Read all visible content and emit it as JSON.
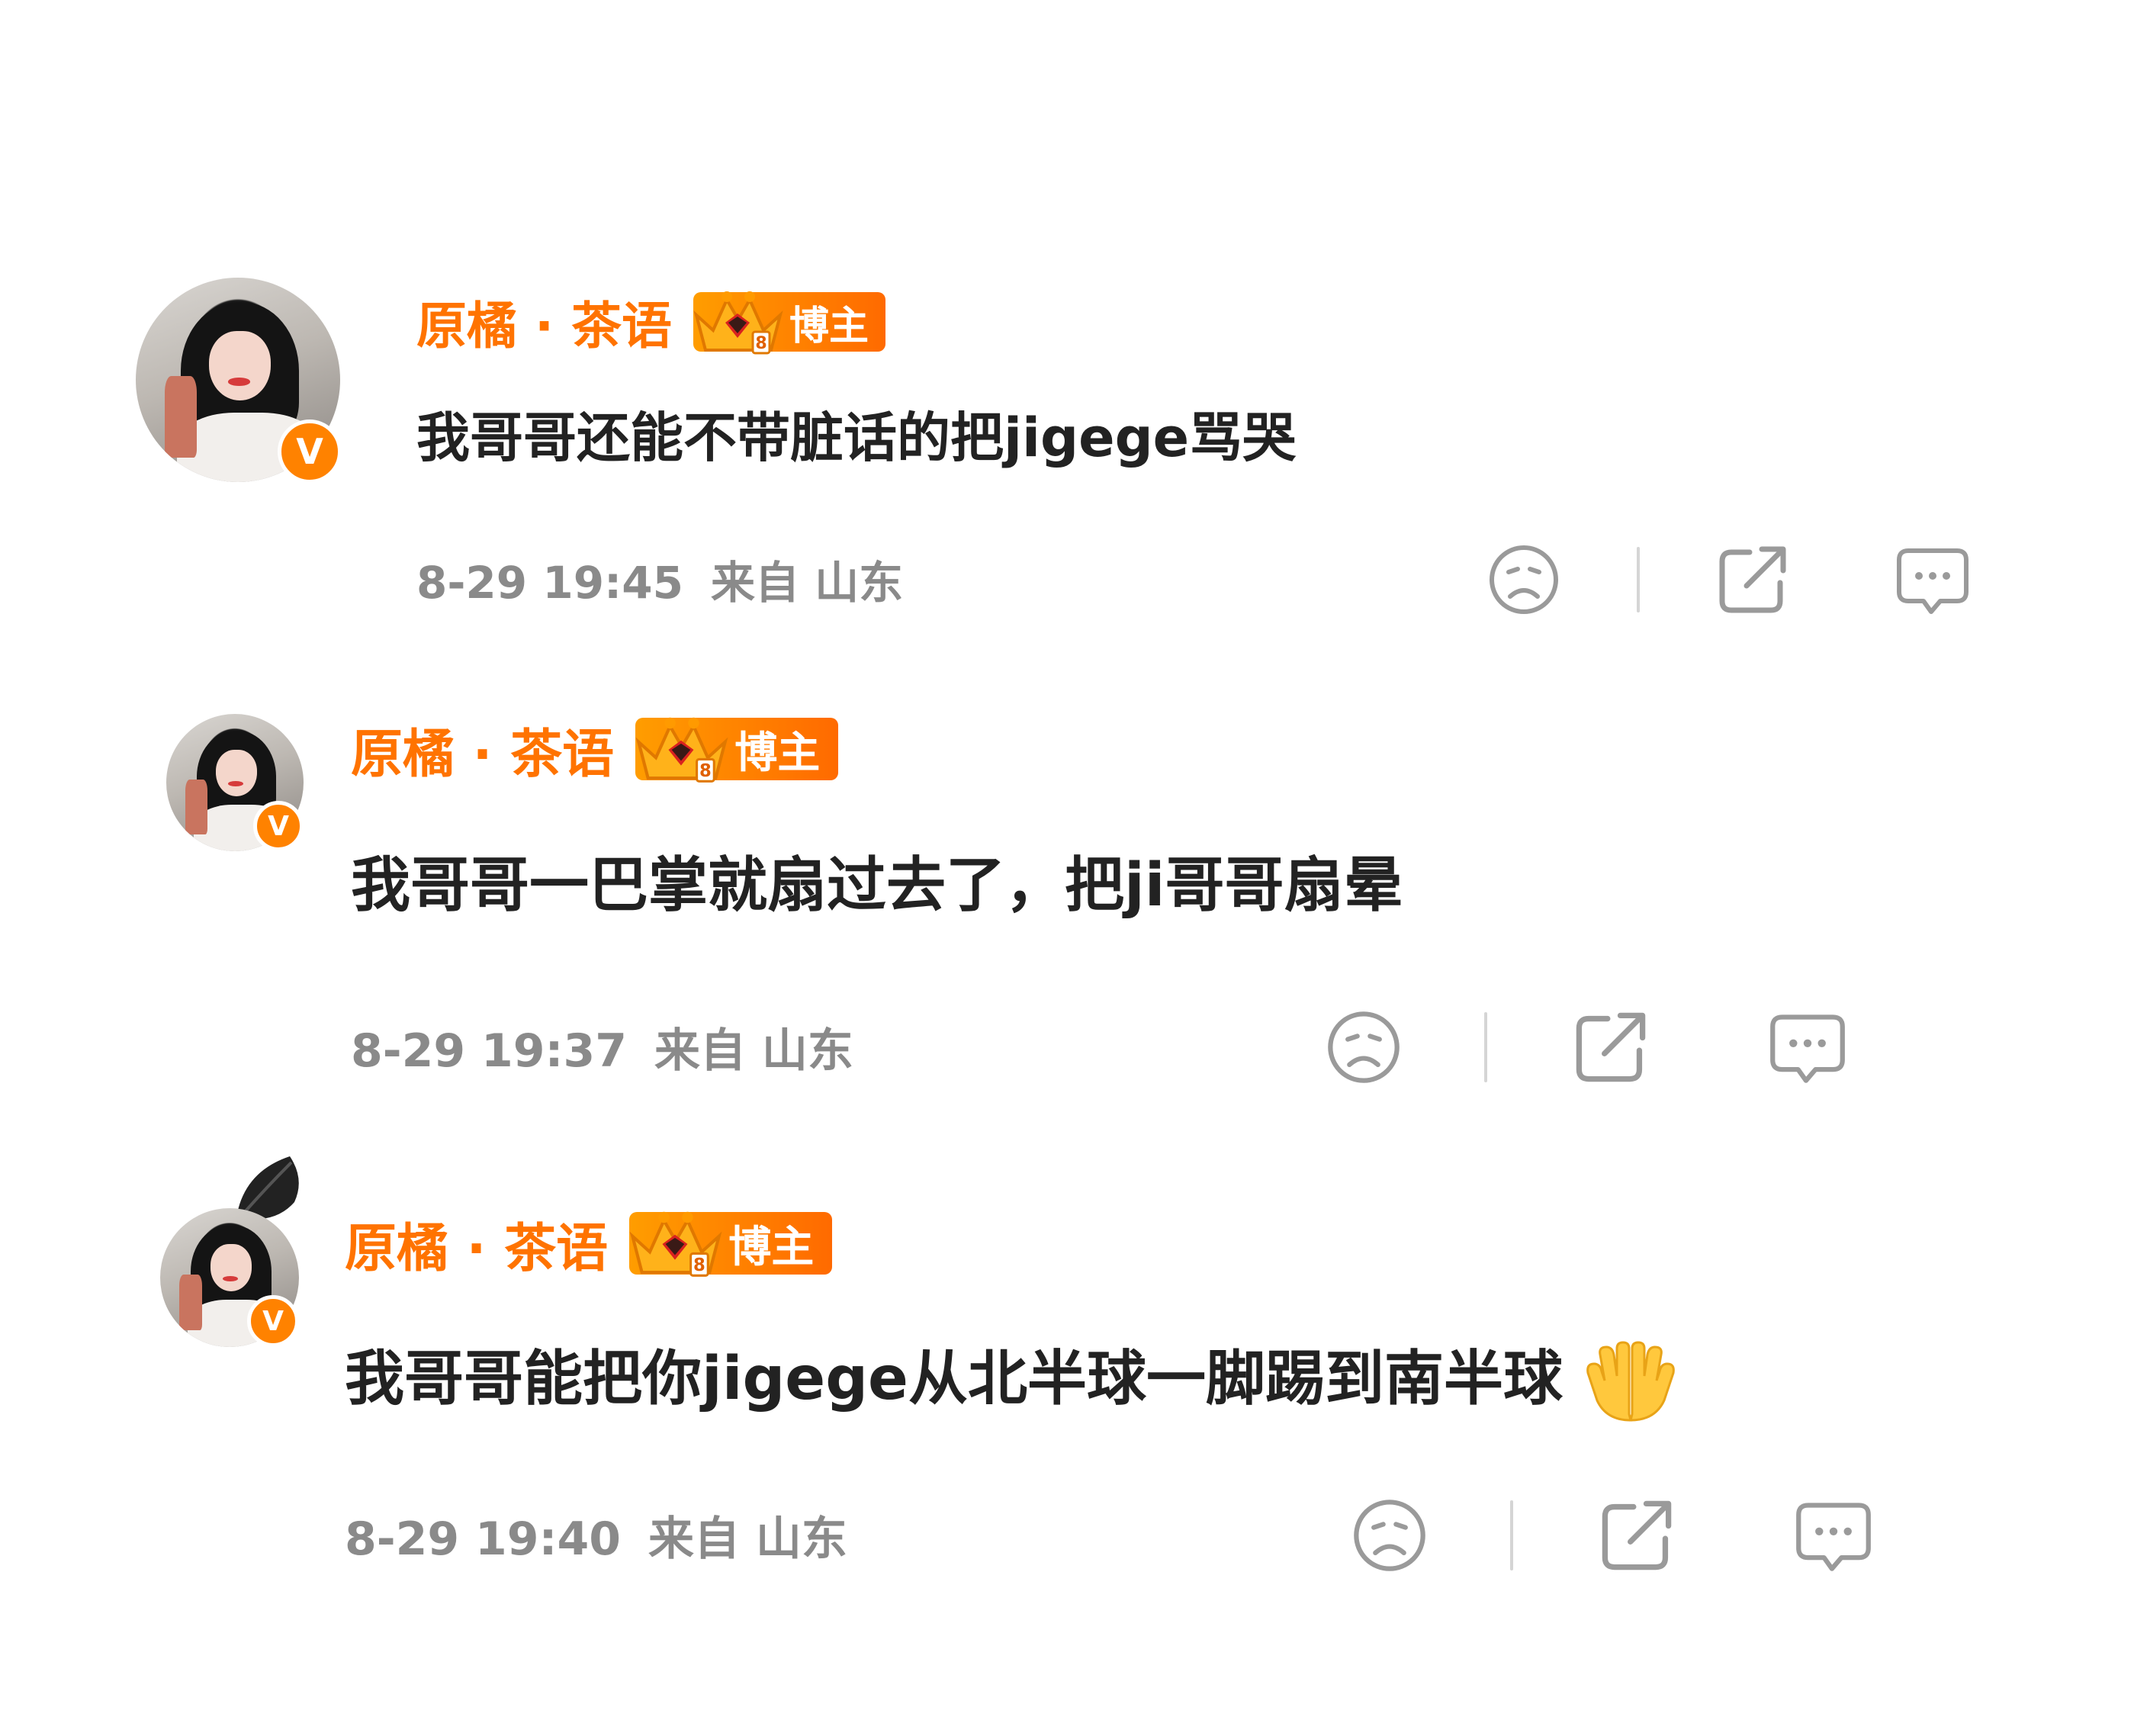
{
  "comments": [
    {
      "username": "原橘 · 茶语",
      "badge_label": "博主",
      "content": "我哥哥还能不带脏话的把jigege骂哭",
      "time": "8-29 19:45",
      "location": "来自 山东"
    },
    {
      "username": "原橘 · 茶语",
      "badge_label": "博主",
      "content": "我哥哥一巴掌就扇过去了，把ji哥哥扇晕",
      "time": "8-29 19:37",
      "location": "来自 山东"
    },
    {
      "username": "原橘 · 茶语",
      "badge_label": "博主",
      "content": "我哥哥能把你jigege从北半球一脚踢到南半球",
      "content_emoji": "palms-up-together-emoji",
      "time": "8-29 19:40",
      "location": "来自 山东"
    }
  ],
  "verified_mark": "V",
  "icons": {
    "dislike": "sad-face-icon",
    "share": "share-icon",
    "comment": "comment-bubble-icon",
    "crown": "crown-icon"
  },
  "colors": {
    "username": "#ff7300",
    "badge": "#ff8200",
    "meta": "#8a8a8a",
    "content": "#222222",
    "icon": "#9a9a9a"
  }
}
